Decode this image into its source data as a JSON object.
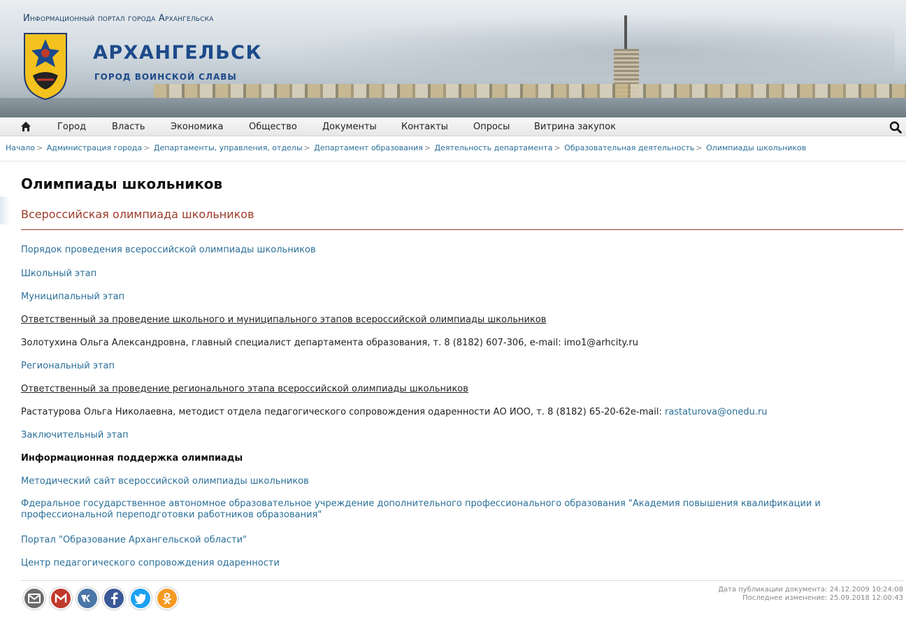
{
  "header": {
    "portal_title": "Информационный портал города Архангельска",
    "city_name": "АРХАНГЕЛЬСК",
    "city_subtitle": "ГОРОД ВОИНСКОЙ СЛАВЫ"
  },
  "nav": {
    "home_icon": "home-icon",
    "items": [
      "Город",
      "Власть",
      "Экономика",
      "Общество",
      "Документы",
      "Контакты",
      "Опросы",
      "Витрина закупок"
    ],
    "search_icon": "search-icon"
  },
  "breadcrumb": [
    "Начало",
    "Администрация города",
    "Департаменты, управления, отделы",
    "Департамент образования",
    "Деятельность департамента",
    "Образовательная деятельность",
    "Олимпиады школьников"
  ],
  "page": {
    "title": "Олимпиады школьников",
    "section_title": "Всероссийская олимпиада школьников",
    "items": [
      {
        "kind": "link",
        "text": "Порядок проведения всероссийской олимпиады школьников"
      },
      {
        "kind": "link",
        "text": "Школьный этап"
      },
      {
        "kind": "link",
        "text": "Муниципальный этап"
      },
      {
        "kind": "underline",
        "text": "Ответственный за проведение школьного и муниципального этапов всероссийской олимпиады школьников"
      },
      {
        "kind": "plain",
        "text": "Золотухина Ольга Александровна, главный специалист департамента образования, т. 8 (8182) 607-306, e-mail: imo1@arhcity.ru"
      },
      {
        "kind": "link",
        "text": "Региональный этап"
      },
      {
        "kind": "underline",
        "text": "Ответственный за проведение регионального этапа всероссийской олимпиады школьников"
      },
      {
        "kind": "plain_with_link",
        "text": "Растатурова Ольга Николаевна, методист отдела педагогического сопровождения одаренности АО ИОО, т. 8 (8182) 65-20-62e-mail: ",
        "link": "rastaturova@onedu.ru"
      },
      {
        "kind": "link",
        "text": "Заключительный этап"
      },
      {
        "kind": "bold",
        "text": "Информационная поддержка олимпиады"
      },
      {
        "kind": "link",
        "text": "Методический сайт всероссийской олимпиады школьников"
      },
      {
        "kind": "link",
        "text": "Фдеральное государственное автономное образовательное учреждение дополнительного профессионального образования \"Академия повышения квалификации и профессиональной переподготовки работников образования\""
      },
      {
        "kind": "link",
        "text": "Портал \"Образование Архангельской области\""
      },
      {
        "kind": "link",
        "text": "Центр педагогического сопровождения одаренности"
      }
    ]
  },
  "footer": {
    "social": [
      {
        "name": "email-share-icon",
        "color": "#6c6c6c"
      },
      {
        "name": "gmail-share-icon",
        "color": "#c0392b"
      },
      {
        "name": "vk-share-icon",
        "color": "#4a76a8"
      },
      {
        "name": "facebook-share-icon",
        "color": "#3b5998"
      },
      {
        "name": "twitter-share-icon",
        "color": "#1da1f2"
      },
      {
        "name": "odnoklassniki-share-icon",
        "color": "#f59a23"
      }
    ],
    "published": "Дата публикации документа: 24.12.2009 10:24:08",
    "modified": "Последнее изменение: 25.09.2018 12:00:43"
  }
}
